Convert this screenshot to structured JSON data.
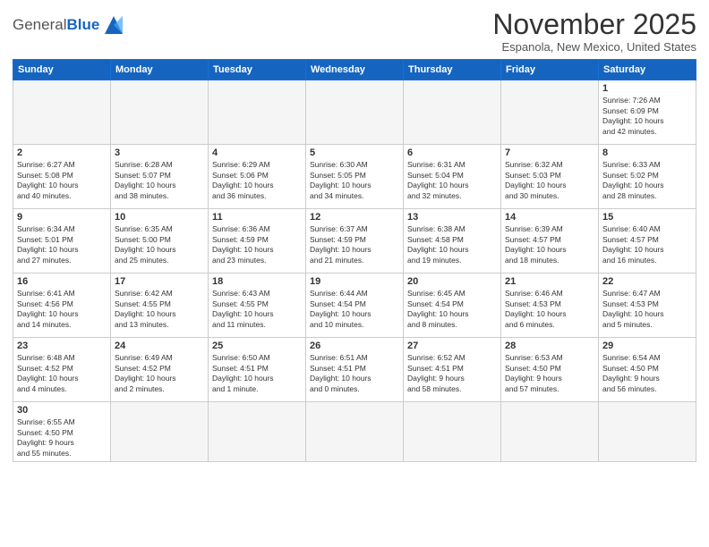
{
  "header": {
    "logo_general": "General",
    "logo_blue": "Blue",
    "month_year": "November 2025",
    "location": "Espanola, New Mexico, United States"
  },
  "days_of_week": [
    "Sunday",
    "Monday",
    "Tuesday",
    "Wednesday",
    "Thursday",
    "Friday",
    "Saturday"
  ],
  "weeks": [
    [
      {
        "day": "",
        "info": ""
      },
      {
        "day": "",
        "info": ""
      },
      {
        "day": "",
        "info": ""
      },
      {
        "day": "",
        "info": ""
      },
      {
        "day": "",
        "info": ""
      },
      {
        "day": "",
        "info": ""
      },
      {
        "day": "1",
        "info": "Sunrise: 7:26 AM\nSunset: 6:09 PM\nDaylight: 10 hours\nand 42 minutes."
      }
    ],
    [
      {
        "day": "2",
        "info": "Sunrise: 6:27 AM\nSunset: 5:08 PM\nDaylight: 10 hours\nand 40 minutes."
      },
      {
        "day": "3",
        "info": "Sunrise: 6:28 AM\nSunset: 5:07 PM\nDaylight: 10 hours\nand 38 minutes."
      },
      {
        "day": "4",
        "info": "Sunrise: 6:29 AM\nSunset: 5:06 PM\nDaylight: 10 hours\nand 36 minutes."
      },
      {
        "day": "5",
        "info": "Sunrise: 6:30 AM\nSunset: 5:05 PM\nDaylight: 10 hours\nand 34 minutes."
      },
      {
        "day": "6",
        "info": "Sunrise: 6:31 AM\nSunset: 5:04 PM\nDaylight: 10 hours\nand 32 minutes."
      },
      {
        "day": "7",
        "info": "Sunrise: 6:32 AM\nSunset: 5:03 PM\nDaylight: 10 hours\nand 30 minutes."
      },
      {
        "day": "8",
        "info": "Sunrise: 6:33 AM\nSunset: 5:02 PM\nDaylight: 10 hours\nand 28 minutes."
      }
    ],
    [
      {
        "day": "9",
        "info": "Sunrise: 6:34 AM\nSunset: 5:01 PM\nDaylight: 10 hours\nand 27 minutes."
      },
      {
        "day": "10",
        "info": "Sunrise: 6:35 AM\nSunset: 5:00 PM\nDaylight: 10 hours\nand 25 minutes."
      },
      {
        "day": "11",
        "info": "Sunrise: 6:36 AM\nSunset: 4:59 PM\nDaylight: 10 hours\nand 23 minutes."
      },
      {
        "day": "12",
        "info": "Sunrise: 6:37 AM\nSunset: 4:59 PM\nDaylight: 10 hours\nand 21 minutes."
      },
      {
        "day": "13",
        "info": "Sunrise: 6:38 AM\nSunset: 4:58 PM\nDaylight: 10 hours\nand 19 minutes."
      },
      {
        "day": "14",
        "info": "Sunrise: 6:39 AM\nSunset: 4:57 PM\nDaylight: 10 hours\nand 18 minutes."
      },
      {
        "day": "15",
        "info": "Sunrise: 6:40 AM\nSunset: 4:57 PM\nDaylight: 10 hours\nand 16 minutes."
      }
    ],
    [
      {
        "day": "16",
        "info": "Sunrise: 6:41 AM\nSunset: 4:56 PM\nDaylight: 10 hours\nand 14 minutes."
      },
      {
        "day": "17",
        "info": "Sunrise: 6:42 AM\nSunset: 4:55 PM\nDaylight: 10 hours\nand 13 minutes."
      },
      {
        "day": "18",
        "info": "Sunrise: 6:43 AM\nSunset: 4:55 PM\nDaylight: 10 hours\nand 11 minutes."
      },
      {
        "day": "19",
        "info": "Sunrise: 6:44 AM\nSunset: 4:54 PM\nDaylight: 10 hours\nand 10 minutes."
      },
      {
        "day": "20",
        "info": "Sunrise: 6:45 AM\nSunset: 4:54 PM\nDaylight: 10 hours\nand 8 minutes."
      },
      {
        "day": "21",
        "info": "Sunrise: 6:46 AM\nSunset: 4:53 PM\nDaylight: 10 hours\nand 6 minutes."
      },
      {
        "day": "22",
        "info": "Sunrise: 6:47 AM\nSunset: 4:53 PM\nDaylight: 10 hours\nand 5 minutes."
      }
    ],
    [
      {
        "day": "23",
        "info": "Sunrise: 6:48 AM\nSunset: 4:52 PM\nDaylight: 10 hours\nand 4 minutes."
      },
      {
        "day": "24",
        "info": "Sunrise: 6:49 AM\nSunset: 4:52 PM\nDaylight: 10 hours\nand 2 minutes."
      },
      {
        "day": "25",
        "info": "Sunrise: 6:50 AM\nSunset: 4:51 PM\nDaylight: 10 hours\nand 1 minute."
      },
      {
        "day": "26",
        "info": "Sunrise: 6:51 AM\nSunset: 4:51 PM\nDaylight: 10 hours\nand 0 minutes."
      },
      {
        "day": "27",
        "info": "Sunrise: 6:52 AM\nSunset: 4:51 PM\nDaylight: 9 hours\nand 58 minutes."
      },
      {
        "day": "28",
        "info": "Sunrise: 6:53 AM\nSunset: 4:50 PM\nDaylight: 9 hours\nand 57 minutes."
      },
      {
        "day": "29",
        "info": "Sunrise: 6:54 AM\nSunset: 4:50 PM\nDaylight: 9 hours\nand 56 minutes."
      }
    ],
    [
      {
        "day": "30",
        "info": "Sunrise: 6:55 AM\nSunset: 4:50 PM\nDaylight: 9 hours\nand 55 minutes."
      },
      {
        "day": "",
        "info": ""
      },
      {
        "day": "",
        "info": ""
      },
      {
        "day": "",
        "info": ""
      },
      {
        "day": "",
        "info": ""
      },
      {
        "day": "",
        "info": ""
      },
      {
        "day": "",
        "info": ""
      }
    ]
  ]
}
